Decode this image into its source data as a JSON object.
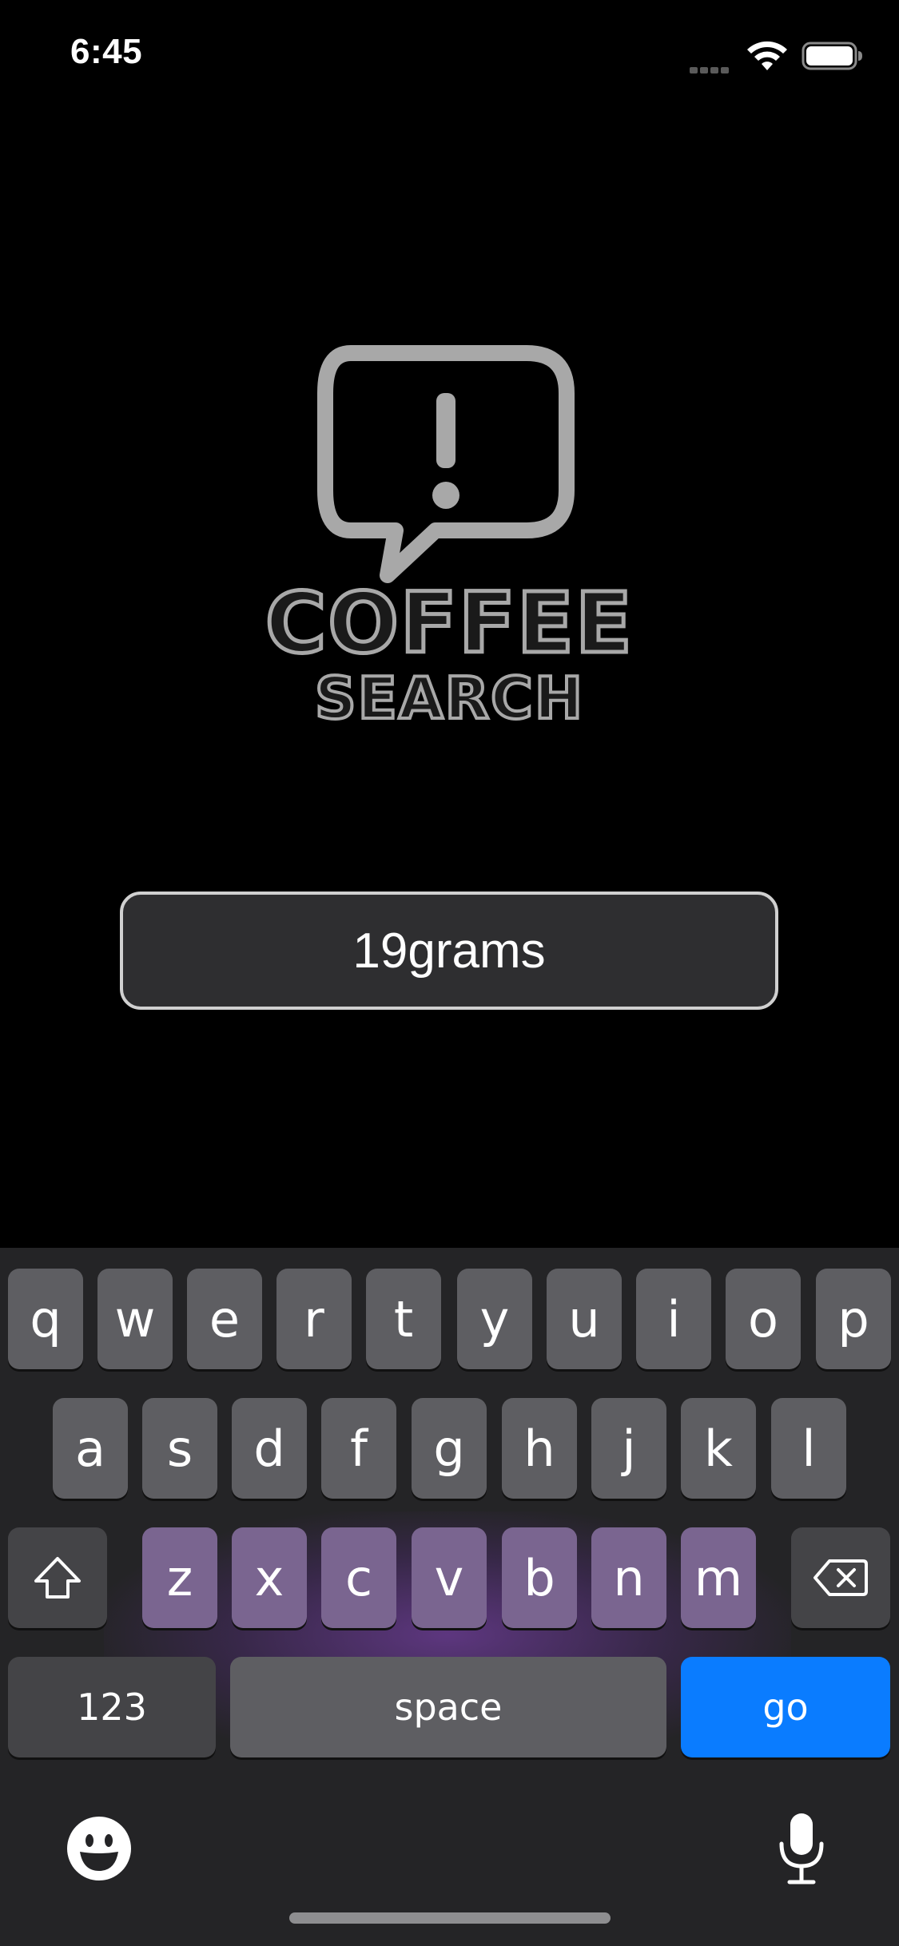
{
  "status_bar": {
    "time": "6:45",
    "icons": [
      "signal-icon",
      "wifi-icon",
      "battery-icon"
    ]
  },
  "logo": {
    "line1": "COFFEE",
    "line2": "SEARCH",
    "icon": "speech-bubble-exclamation-icon",
    "color": "#a8a8a8"
  },
  "search": {
    "value": "19grams",
    "border_color": "#d0d0d0"
  },
  "keyboard": {
    "row1": [
      "q",
      "w",
      "e",
      "r",
      "t",
      "y",
      "u",
      "i",
      "o",
      "p"
    ],
    "row2": [
      "a",
      "s",
      "d",
      "f",
      "g",
      "h",
      "j",
      "k",
      "l"
    ],
    "row3": [
      "z",
      "x",
      "c",
      "v",
      "b",
      "n",
      "m"
    ],
    "numbers_label": "123",
    "space_label": "space",
    "go_label": "go",
    "go_color": "#0a7cff",
    "highlight_color": "#7a6590",
    "icons": [
      "shift-icon",
      "backspace-icon",
      "emoji-icon",
      "microphone-icon"
    ]
  }
}
